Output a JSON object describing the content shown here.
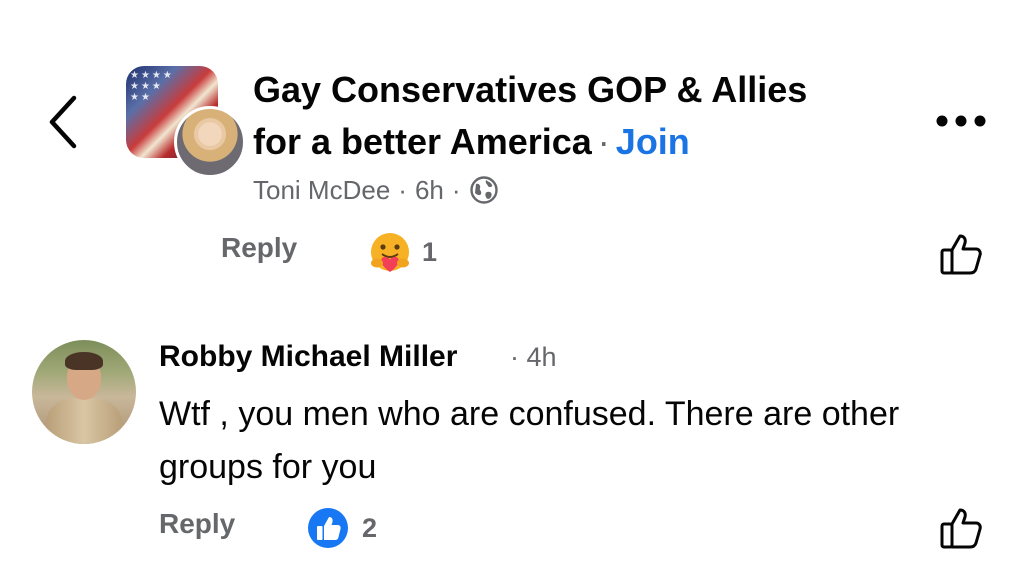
{
  "post": {
    "group_name_line1": "Gay Conservatives GOP & Allies",
    "group_name_line2": "for a better America",
    "separator": "·",
    "join_label": "Join",
    "author": "Toni McDee",
    "time": "6h",
    "privacy_icon": "globe-icon",
    "reply_label": "Reply",
    "reaction_icon": "care-emoji-icon",
    "reaction_count": "1"
  },
  "comment": {
    "author": "Robby Michael Miller",
    "time": "4h",
    "text": "Wtf , you men who are confused. There are other groups for you",
    "reply_label": "Reply",
    "reaction_icon": "like-badge-icon",
    "reaction_count": "2"
  },
  "colors": {
    "text_primary": "#050505",
    "text_secondary": "#65676b",
    "link": "#1b74e4"
  }
}
